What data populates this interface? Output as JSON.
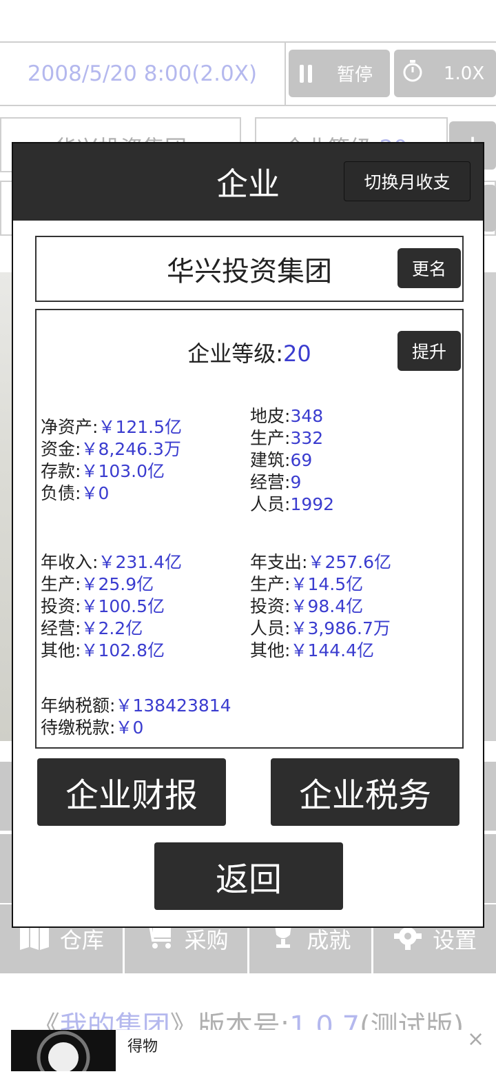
{
  "topbar": {
    "datetime": "2008/5/20 8:00(2.0X)",
    "pause_label": "暂停",
    "speed_label": "1.0X"
  },
  "background": {
    "company_tab": "华兴投资集团",
    "level_tab_label": "企业等级:",
    "level_tab_value": "20"
  },
  "nav": [
    {
      "label": "仓库",
      "icon": "warehouse-icon"
    },
    {
      "label": "采购",
      "icon": "cart-icon"
    },
    {
      "label": "成就",
      "icon": "trophy-icon"
    },
    {
      "label": "设置",
      "icon": "gear-icon"
    }
  ],
  "footer": {
    "version_prefix": "《",
    "game_name": "我的集团",
    "version_mid": "》版本号:",
    "version_number": "1.0.7",
    "version_suffix": "(测试版)"
  },
  "ad": {
    "title": "得物",
    "close": "×"
  },
  "modal": {
    "title": "企业",
    "switch_label": "切换月收支",
    "company_name": "华兴投资集团",
    "rename_label": "更名",
    "level_label": "企业等级:",
    "level_value": "20",
    "upgrade_label": "提升",
    "assets": [
      {
        "label": "净资产:",
        "value": "￥121.5亿"
      },
      {
        "label": "资金:",
        "value": "￥8,246.3万"
      },
      {
        "label": "存款:",
        "value": "￥103.0亿"
      },
      {
        "label": "负债:",
        "value": "￥0"
      }
    ],
    "counts": [
      {
        "label": "地皮:",
        "value": "348"
      },
      {
        "label": "生产:",
        "value": "332"
      },
      {
        "label": "建筑:",
        "value": "69"
      },
      {
        "label": "经营:",
        "value": "9"
      },
      {
        "label": "人员:",
        "value": "1992"
      }
    ],
    "income": [
      {
        "label": "年收入:",
        "value": "￥231.4亿"
      },
      {
        "label": "生产:",
        "value": "￥25.9亿"
      },
      {
        "label": "投资:",
        "value": "￥100.5亿"
      },
      {
        "label": "经营:",
        "value": "￥2.2亿"
      },
      {
        "label": "其他:",
        "value": "￥102.8亿"
      }
    ],
    "expense": [
      {
        "label": "年支出:",
        "value": "￥257.6亿"
      },
      {
        "label": "生产:",
        "value": "￥14.5亿"
      },
      {
        "label": "投资:",
        "value": "￥98.4亿"
      },
      {
        "label": "人员:",
        "value": "￥3,986.7万"
      },
      {
        "label": "其他:",
        "value": "￥144.4亿"
      }
    ],
    "tax": [
      {
        "label": "年纳税额:",
        "value": "￥138423814"
      },
      {
        "label": "待缴税款:",
        "value": "￥0"
      }
    ],
    "report_label": "企业财报",
    "tax_label": "企业税务",
    "back_label": "返回"
  }
}
